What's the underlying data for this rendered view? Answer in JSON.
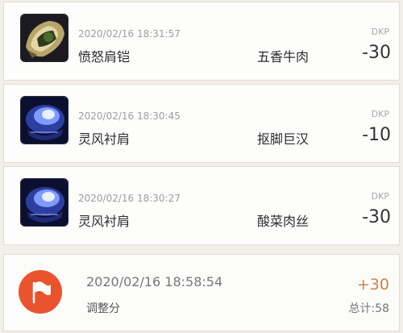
{
  "loot": [
    {
      "time": "2020/02/16 18:31:57",
      "item": "愤怒肩铠",
      "player": "五香牛肉",
      "dkp_label": "DKP",
      "dkp": "-30",
      "icon": "gold-shoulder-armor-icon"
    },
    {
      "time": "2020/02/16 18:30:45",
      "item": "灵风衬肩",
      "player": "抠脚巨汉",
      "dkp_label": "DKP",
      "dkp": "-10",
      "icon": "blue-glow-shoulder-icon"
    },
    {
      "time": "2020/02/16 18:30:27",
      "item": "灵风衬肩",
      "player": "酸菜肉丝",
      "dkp_label": "DKP",
      "dkp": "-30",
      "icon": "blue-glow-shoulder-icon"
    }
  ],
  "adjustment": {
    "time": "2020/02/16 18:58:54",
    "label": "调整分",
    "value": "+30",
    "total": "总计:58",
    "icon": "flag-icon",
    "icon_color": "#e9532e",
    "value_color": "#c8854a"
  }
}
